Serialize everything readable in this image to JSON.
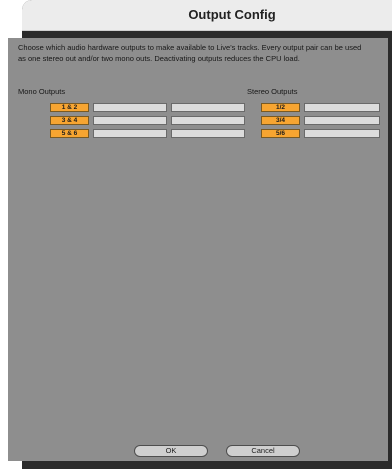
{
  "window": {
    "title": "Output Config"
  },
  "description": "Choose which audio hardware outputs to make available to Live's tracks. Every output pair can be used as one stereo out and/or two mono outs.  Deactivating outputs reduces the CPU load.",
  "mono": {
    "label": "Mono Outputs",
    "rows": [
      {
        "label": "1 & 2",
        "active": true,
        "mono_left_active": false,
        "mono_right_active": false
      },
      {
        "label": "3 & 4",
        "active": true,
        "mono_left_active": false,
        "mono_right_active": false
      },
      {
        "label": "5 & 6",
        "active": true,
        "mono_left_active": false,
        "mono_right_active": false
      }
    ]
  },
  "stereo": {
    "label": "Stereo Outputs",
    "rows": [
      {
        "label": "1/2",
        "active": true,
        "next_active": false
      },
      {
        "label": "3/4",
        "active": true,
        "next_active": false
      },
      {
        "label": "5/6",
        "active": true,
        "next_active": false
      }
    ]
  },
  "buttons": {
    "ok": "OK",
    "cancel": "Cancel"
  },
  "colors": {
    "active": "#f7a531",
    "inactive": "#dcdcdc",
    "panel": "#8e8e8e",
    "frame": "#2b2b2b"
  }
}
